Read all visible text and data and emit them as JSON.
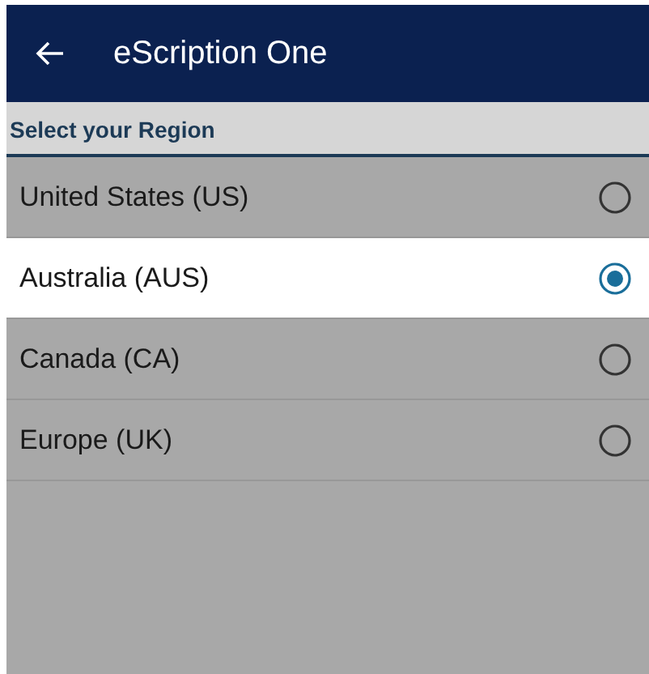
{
  "app_bar": {
    "title": "eScription One"
  },
  "section": {
    "title": "Select your Region"
  },
  "regions": [
    {
      "label": "United States (US)",
      "selected": false
    },
    {
      "label": "Australia (AUS)",
      "selected": true
    },
    {
      "label": "Canada (CA)",
      "selected": false
    },
    {
      "label": "Europe (UK)",
      "selected": false
    }
  ]
}
